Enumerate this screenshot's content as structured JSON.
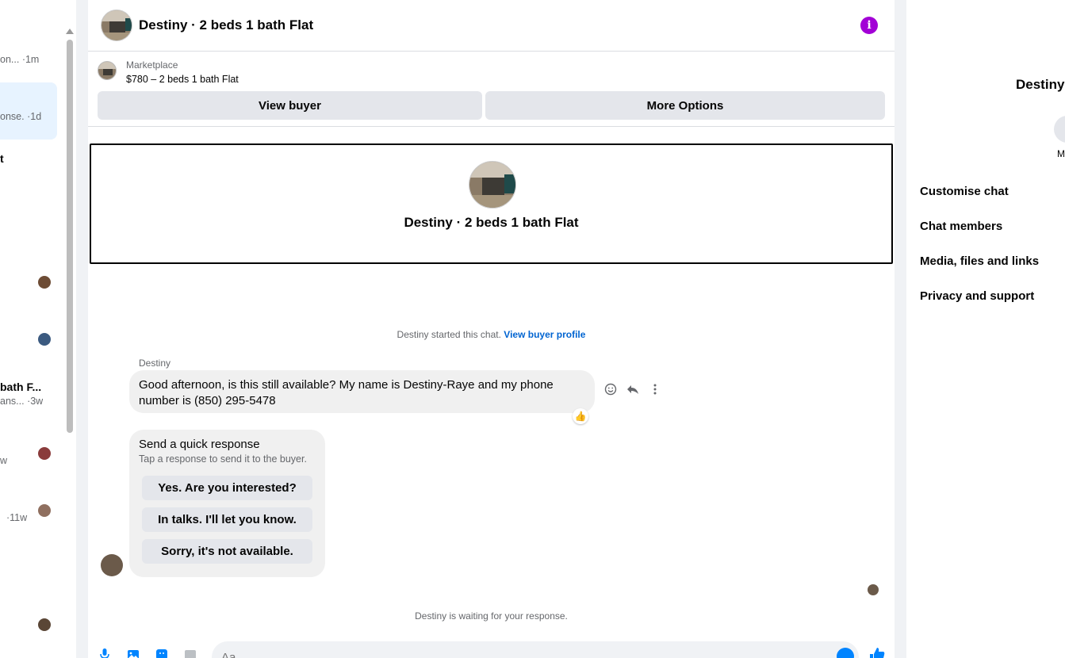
{
  "left_list": {
    "items": [
      {
        "line1": "",
        "line2": "on...",
        "time": "·1m"
      },
      {
        "line1": "",
        "line2": "onse.",
        "time": "·1d",
        "selected": true
      },
      {
        "line1": "t",
        "line2": "",
        "time": ""
      },
      {
        "line1": "bath F...",
        "line2": "ans...",
        "time": "·3w"
      },
      {
        "line1": "",
        "line2": "w",
        "time": ""
      },
      {
        "line1": "",
        "line2": "",
        "time": "·11w"
      }
    ]
  },
  "header": {
    "title": "Destiny · 2 beds 1 bath Flat",
    "info_icon": "i"
  },
  "marketplace": {
    "label": "Marketplace",
    "listing": "$780 – 2 beds 1 bath Flat",
    "view_buyer": "View buyer",
    "more_options": "More Options"
  },
  "banner": {
    "title": "Destiny · 2 beds 1 bath Flat"
  },
  "chat": {
    "started_text": "Destiny started this chat.",
    "view_profile_link": "View buyer profile",
    "sender_name": "Destiny",
    "message": "Good afternoon, is this still available? My name is Destiny-Raye and my phone number is (850) 295-5478",
    "reaction": "👍",
    "quick_response": {
      "title": "Send a quick response",
      "subtitle": "Tap a response to send it to the buyer.",
      "options": [
        "Yes. Are you interested?",
        "In talks. I'll let you know.",
        "Sorry, it's not available."
      ]
    },
    "waiting_text": "Destiny is waiting for your response."
  },
  "composer": {
    "placeholder": "Aa"
  },
  "right_panel": {
    "name": "Destiny",
    "circle_label": "M",
    "items": [
      "Customise chat",
      "Chat members",
      "Media, files and links",
      "Privacy and support"
    ]
  },
  "colors": {
    "accent": "#0084ff",
    "info": "#a200d6",
    "link": "#0064d1"
  }
}
